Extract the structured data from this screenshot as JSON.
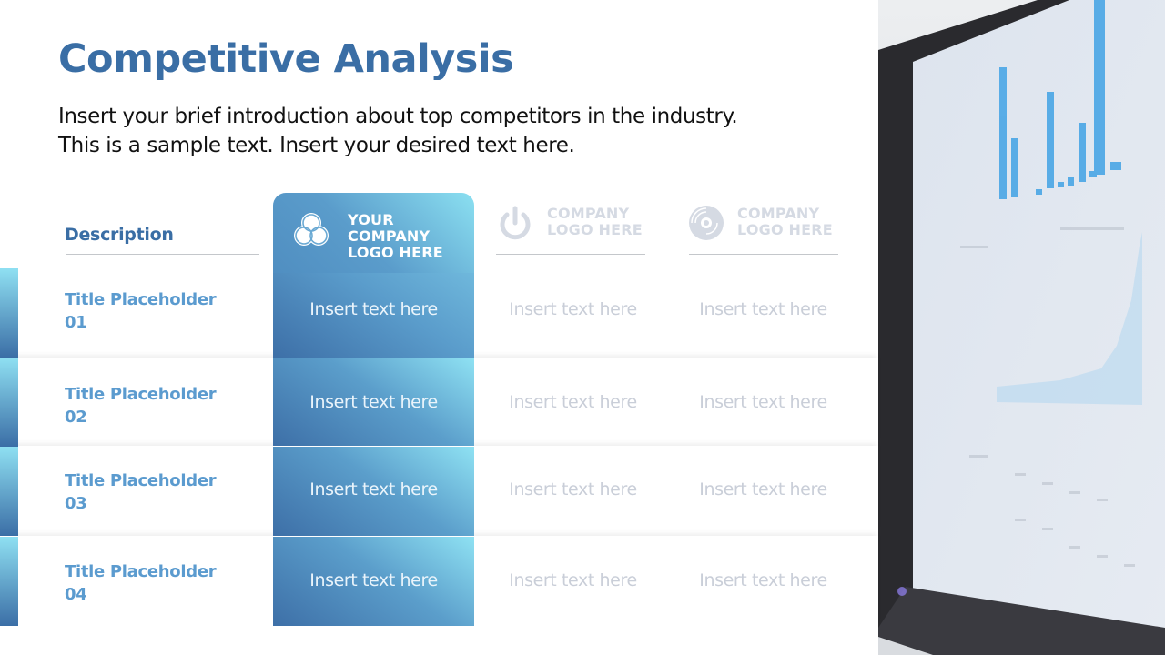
{
  "slide": {
    "title": "Competitive Analysis",
    "intro_lines": [
      "Insert your brief introduction about top competitors in the industry.",
      "This is a sample text. Insert your desired text here."
    ]
  },
  "table": {
    "description_header": "Description",
    "columns": [
      {
        "logo_icon": "venn-circles-icon",
        "lines": [
          "YOUR",
          "COMPANY",
          "LOGO HERE"
        ],
        "highlighted": true
      },
      {
        "logo_icon": "power-icon",
        "lines": [
          "COMPANY",
          "LOGO HERE"
        ],
        "highlighted": false
      },
      {
        "logo_icon": "disc-icon",
        "lines": [
          "COMPANY",
          "LOGO HERE"
        ],
        "highlighted": false
      }
    ],
    "rows": [
      {
        "title_line1": "Title Placeholder",
        "title_line2": "01",
        "cells": [
          "Insert text here",
          "Insert text here",
          "Insert text here"
        ]
      },
      {
        "title_line1": "Title Placeholder",
        "title_line2": "02",
        "cells": [
          "Insert text here",
          "Insert text here",
          "Insert text here"
        ]
      },
      {
        "title_line1": "Title Placeholder",
        "title_line2": "03",
        "cells": [
          "Insert text here",
          "Insert text here",
          "Insert text here"
        ]
      },
      {
        "title_line1": "Title Placeholder",
        "title_line2": "04",
        "cells": [
          "Insert text here",
          "Insert text here",
          "Insert text here"
        ]
      }
    ]
  },
  "colors": {
    "title": "#3a6ea5",
    "row_title": "#5b9bcf",
    "highlight_light": "#8be0f1",
    "highlight_dark": "#3d6fa7",
    "muted_text": "#c9ced8"
  },
  "photo": {
    "subject": "blurred-monitor-with-bar-chart"
  }
}
